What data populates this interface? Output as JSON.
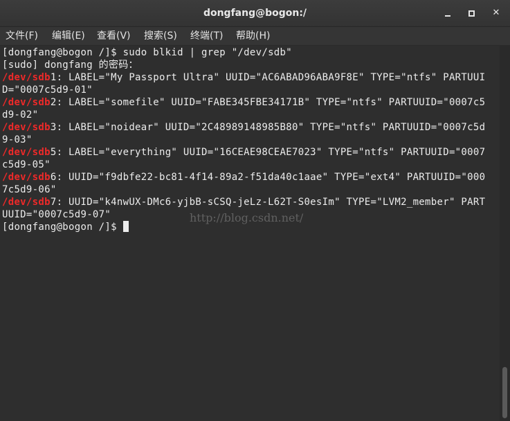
{
  "window": {
    "title": "dongfang@bogon:/"
  },
  "menu": [
    {
      "label": "文件(F)"
    },
    {
      "label": "编辑(E)"
    },
    {
      "label": "查看(V)"
    },
    {
      "label": "搜索(S)"
    },
    {
      "label": "终端(T)"
    },
    {
      "label": "帮助(H)"
    }
  ],
  "terminal": {
    "lines": [
      {
        "text": "[dongfang@bogon /]$ sudo blkid | grep \"/dev/sdb\""
      },
      {
        "text": "[sudo] dongfang 的密码："
      },
      {
        "dev": "/dev/sdb",
        "text": "1: LABEL=\"My Passport Ultra\" UUID=\"AC6ABAD96ABA9F8E\" TYPE=\"ntfs\" PARTUUI"
      },
      {
        "text": "D=\"0007c5d9-01\""
      },
      {
        "dev": "/dev/sdb",
        "text": "2: LABEL=\"somefile\" UUID=\"FABE345FBE34171B\" TYPE=\"ntfs\" PARTUUID=\"0007c5"
      },
      {
        "text": "d9-02\""
      },
      {
        "dev": "/dev/sdb",
        "text": "3: LABEL=\"noidear\" UUID=\"2C48989148985B80\" TYPE=\"ntfs\" PARTUUID=\"0007c5d"
      },
      {
        "text": "9-03\""
      },
      {
        "dev": "/dev/sdb",
        "text": "5: LABEL=\"everything\" UUID=\"16CEAE98CEAE7023\" TYPE=\"ntfs\" PARTUUID=\"0007"
      },
      {
        "text": "c5d9-05\""
      },
      {
        "dev": "/dev/sdb",
        "text": "6: UUID=\"f9dbfe22-bc81-4f14-89a2-f51da40c1aae\" TYPE=\"ext4\" PARTUUID=\"000"
      },
      {
        "text": "7c5d9-06\""
      },
      {
        "dev": "/dev/sdb",
        "text": "7: UUID=\"k4nwUX-DMc6-yjbB-sCSQ-jeLz-L62T-S0esIm\" TYPE=\"LVM2_member\" PART"
      },
      {
        "text": "UUID=\"0007c5d9-07\""
      },
      {
        "text": "[dongfang@bogon /]$ "
      }
    ]
  },
  "watermark": "http://blog.csdn.net/",
  "colors": {
    "device_path": "#ef2929",
    "foreground": "#ececec",
    "background": "#2e2e2e"
  }
}
